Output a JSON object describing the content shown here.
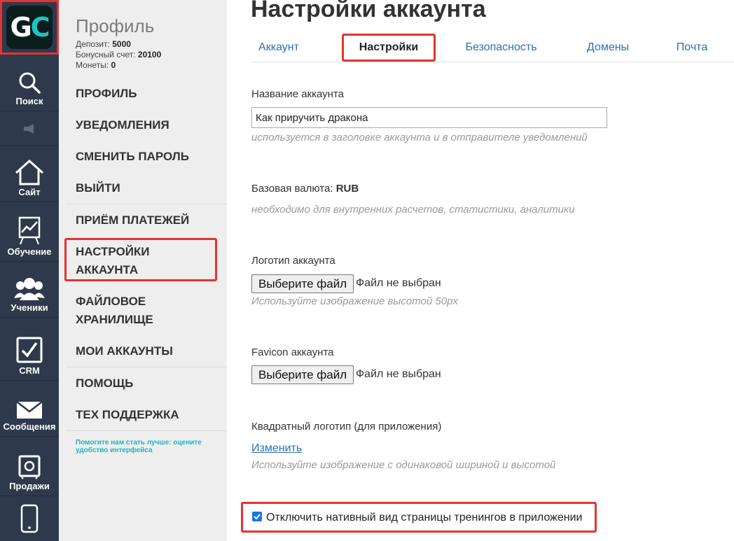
{
  "iconbar": {
    "logo": {
      "g": "G",
      "c": "C"
    },
    "items": [
      {
        "label": "Поиск",
        "icon": "search-icon"
      },
      {
        "label": "",
        "icon": "megaphone-icon"
      },
      {
        "label": "Сайт",
        "icon": "home-icon"
      },
      {
        "label": "Обучение",
        "icon": "chart-board-icon"
      },
      {
        "label": "Ученики",
        "icon": "users-icon"
      },
      {
        "label": "CRM",
        "icon": "checkbox-icon"
      },
      {
        "label": "Сообщения",
        "icon": "envelope-icon"
      },
      {
        "label": "Продажи",
        "icon": "safe-icon"
      },
      {
        "label": "",
        "icon": "phone-icon"
      }
    ]
  },
  "sidebar": {
    "title": "Профиль",
    "stats": {
      "deposit_label": "Депозит:",
      "deposit_value": "5000",
      "bonus_label": "Бонусный счет:",
      "bonus_value": "20100",
      "coins_label": "Монеты:",
      "coins_value": "0"
    },
    "menu": [
      "Профиль",
      "Уведомления",
      "Сменить пароль",
      "Выйти",
      "Приём платежей",
      "Настройки аккаунта",
      "Файловое хранилище",
      "Мои аккаунты",
      "Помощь",
      "Тех поддержка"
    ],
    "feedback": "Помогите нам стать лучше: оцените удобство интерфейса"
  },
  "main": {
    "title": "Настройки аккаунта",
    "tabs": [
      "Аккаунт",
      "Настройки",
      "Безопасность",
      "Домены",
      "Почта"
    ],
    "active_tab": "Настройки",
    "account_name": {
      "label": "Название аккаунта",
      "value": "Как приручить дракона",
      "hint": "используется в заголовке аккаунта и в отправителе уведомлений"
    },
    "currency": {
      "label": "Базовая валюта:",
      "value": "RUB",
      "hint": "необходимо для внутренних расчетов, статистики, аналитики"
    },
    "logo": {
      "label": "Логотип аккаунта",
      "button": "Выберите файл",
      "status": "Файл не выбран",
      "hint": "Используйте изображение высотой 50px"
    },
    "favicon": {
      "label": "Favicon аккаунта",
      "button": "Выберите файл",
      "status": "Файл не выбран"
    },
    "square_logo": {
      "label": "Квадратный логотип (для приложения)",
      "link": "Изменить",
      "hint": "Используйте изображение с одинаковой шириной и высотой"
    },
    "native_view": {
      "label": "Отключить нативный вид страницы тренингов в приложении",
      "checked": true
    }
  },
  "colors": {
    "iconbar_bg": "#2e3a4c",
    "sidebar_bg": "#eeeeee",
    "highlight": "#e3342f",
    "link": "#2c6fb3",
    "brand_teal": "#1ec5c0"
  }
}
